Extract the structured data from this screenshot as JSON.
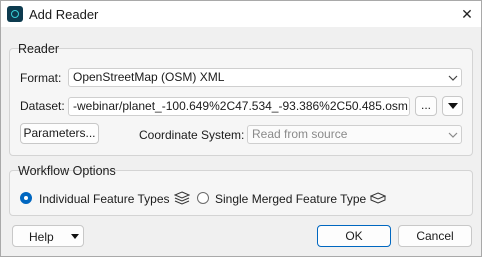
{
  "window": {
    "title": "Add Reader",
    "close_glyph": "✕"
  },
  "reader": {
    "group_title": "Reader",
    "format_label": "Format:",
    "format_value": "OpenStreetMap (OSM) XML",
    "dataset_label": "Dataset:",
    "dataset_value": "-webinar/planet_-100.649%2C47.534_-93.386%2C50.485.osm.pbf",
    "browse_label": "...",
    "parameters_label": "Parameters...",
    "coord_label": "Coordinate System:",
    "coord_value": "Read from source"
  },
  "workflow": {
    "group_title": "Workflow Options",
    "option_individual": "Individual Feature Types",
    "option_merged": "Single Merged Feature Type",
    "selected": "individual"
  },
  "footer": {
    "help_label": "Help",
    "ok_label": "OK",
    "cancel_label": "Cancel"
  },
  "colors": {
    "accent": "#0067c0"
  },
  "icons": [
    "app-icon",
    "close-icon",
    "chevron-down-icon",
    "dropdown-triangle-icon",
    "feature-stack-icon"
  ]
}
